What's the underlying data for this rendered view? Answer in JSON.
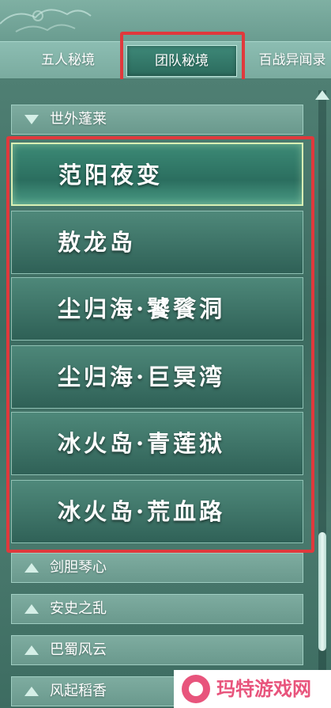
{
  "tabs": [
    {
      "label": "五人秘境",
      "active": false
    },
    {
      "label": "团队秘境",
      "active": true
    },
    {
      "label": "百战异闻录",
      "active": false
    }
  ],
  "expanded_group": {
    "label": "世外蓬莱"
  },
  "dungeons": [
    {
      "label": "范阳夜变",
      "selected": true
    },
    {
      "label": "敖龙岛",
      "selected": false
    },
    {
      "label": "尘归海·饕餮洞",
      "selected": false
    },
    {
      "label": "尘归海·巨冥湾",
      "selected": false
    },
    {
      "label": "冰火岛·青莲狱",
      "selected": false
    },
    {
      "label": "冰火岛·荒血路",
      "selected": false
    }
  ],
  "collapsed_groups": [
    {
      "label": "剑胆琴心"
    },
    {
      "label": "安史之乱"
    },
    {
      "label": "巴蜀风云"
    },
    {
      "label": "风起稻香"
    }
  ],
  "watermark": {
    "text": "玛特游戏网"
  },
  "colors": {
    "highlight": "#e0393c",
    "accent": "#2b6b5d",
    "watermark": "#e8547c"
  }
}
